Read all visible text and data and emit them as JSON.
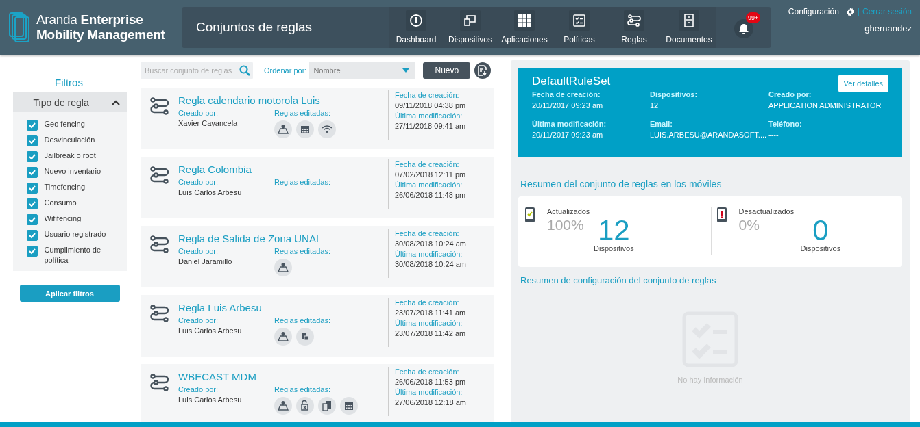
{
  "brand": {
    "light": "Aranda",
    "bold_line1": "Enterprise",
    "line2": "Mobility Management"
  },
  "page_title": "Conjuntos de reglas",
  "nav": [
    {
      "label": "Dashboard",
      "kind": "gauge"
    },
    {
      "label": "Dispositivos",
      "kind": "devices"
    },
    {
      "label": "Aplicaciones",
      "kind": "grid"
    },
    {
      "label": "Políticas",
      "kind": "checklist"
    },
    {
      "label": "Reglas",
      "kind": "rules"
    },
    {
      "label": "Documentos",
      "kind": "cabinet"
    }
  ],
  "notifications": {
    "badge": "99+"
  },
  "user_menu": {
    "settings": "Configuración",
    "separator": "|",
    "logout": "Cerrar sesión",
    "username": "ghernandez"
  },
  "filters": {
    "title": "Filtros",
    "group": {
      "label": "Tipo de regla",
      "expanded": true
    },
    "options": [
      {
        "label": "Geo fencing",
        "checked": true
      },
      {
        "label": "Desvinculación",
        "checked": true
      },
      {
        "label": "Jailbreak o root",
        "checked": true
      },
      {
        "label": "Nuevo inventario",
        "checked": true
      },
      {
        "label": "Timefencing",
        "checked": true
      },
      {
        "label": "Consumo",
        "checked": true
      },
      {
        "label": "Wififencing",
        "checked": true
      },
      {
        "label": "Usuario registrado",
        "checked": true
      },
      {
        "label": "Cumplimiento de política",
        "checked": true
      }
    ],
    "apply_button": "Aplicar filtros"
  },
  "toolbar": {
    "search": {
      "placeholder": "Buscar conjunto de reglas"
    },
    "sort_label": "Ordenar por:",
    "sort_value": "Nombre",
    "new_button": "Nuevo"
  },
  "rule_sets": [
    {
      "name": "Regla calendario motorola Luis",
      "created_by_label": "Creado por:",
      "created_by": "Xavier Cayancela",
      "rules_label": "Reglas editadas:",
      "rules": [
        {
          "kind": "geo"
        },
        {
          "kind": "calendar"
        },
        {
          "kind": "wifi"
        }
      ],
      "created_label": "Fecha de creación:",
      "created": "09/11/2018 04:38 pm",
      "modified_label": "Última modificación:",
      "modified": "27/11/2018 09:41 am"
    },
    {
      "name": "Regla Colombia",
      "created_by_label": "Creado por:",
      "created_by": "Luis Carlos Arbesu",
      "rules_label": "Reglas editadas:",
      "created_label": "Fecha de creación:",
      "created": "07/02/2018 12:11 pm",
      "modified_label": "Última modificación:",
      "modified": "26/06/2018 11:48 pm"
    },
    {
      "name": "Regla de Salida de Zona UNAL",
      "created_by_label": "Creado por:",
      "created_by": "Daniel Jaramillo",
      "rules_label": "Reglas editadas:",
      "rules": [
        {
          "kind": "geo"
        }
      ],
      "created_label": "Fecha de creación:",
      "created": "30/08/2018 10:24 am",
      "modified_label": "Última modificación:",
      "modified": "30/08/2018 10:24 am"
    },
    {
      "name": "Regla Luis Arbesu",
      "created_by_label": "Creado por:",
      "created_by": "Luis Carlos Arbesu",
      "rules_label": "Reglas editadas:",
      "rules": [
        {
          "kind": "geo"
        },
        {
          "kind": "sim"
        }
      ],
      "created_label": "Fecha de creación:",
      "created": "23/07/2018 11:41 am",
      "modified_label": "Última modificación:",
      "modified": "23/07/2018 11:42 am"
    },
    {
      "name": "WBECAST MDM",
      "created_by_label": "Creado por:",
      "created_by": "Luis Carlos Arbesu",
      "rules_label": "Reglas editadas:",
      "rules": [
        {
          "kind": "geo"
        },
        {
          "kind": "unlock"
        },
        {
          "kind": "copy"
        },
        {
          "kind": "calendar"
        }
      ],
      "created_label": "Fecha de creación:",
      "created": "26/06/2018 11:53 pm",
      "modified_label": "Última modificación:",
      "modified": "27/06/2018 12:18 am"
    }
  ],
  "detail": {
    "name": "DefaultRuleSet",
    "details_button": "Ver detalles",
    "fields": [
      {
        "label": "Fecha de creación:",
        "value": "20/11/2017 09:23 am"
      },
      {
        "label": "Dispositivos:",
        "value": "12"
      },
      {
        "label": "Creado por:",
        "value": "APPLICATION ADMINISTRATOR"
      },
      {
        "label": "Última modificación:",
        "value": "20/11/2017 09:23 am"
      },
      {
        "label": "Email:",
        "value": "LUIS.ARBESU@ARANDASOFT...."
      },
      {
        "label": "Teléfono:",
        "value": "----"
      }
    ],
    "summary_title": "Resumen del conjunto de reglas en los móviles",
    "stats": [
      {
        "kind": "ok",
        "label": "Actualizados",
        "percent": "100%",
        "count": "12",
        "unit": "Dispositivos"
      },
      {
        "kind": "warn",
        "label": "Desactualizados",
        "percent": "0%",
        "count": "0",
        "unit": "Dispositivos"
      }
    ],
    "config_title": "Resumen de configuración del conjunto de reglas",
    "empty_text": "No hay Información"
  }
}
